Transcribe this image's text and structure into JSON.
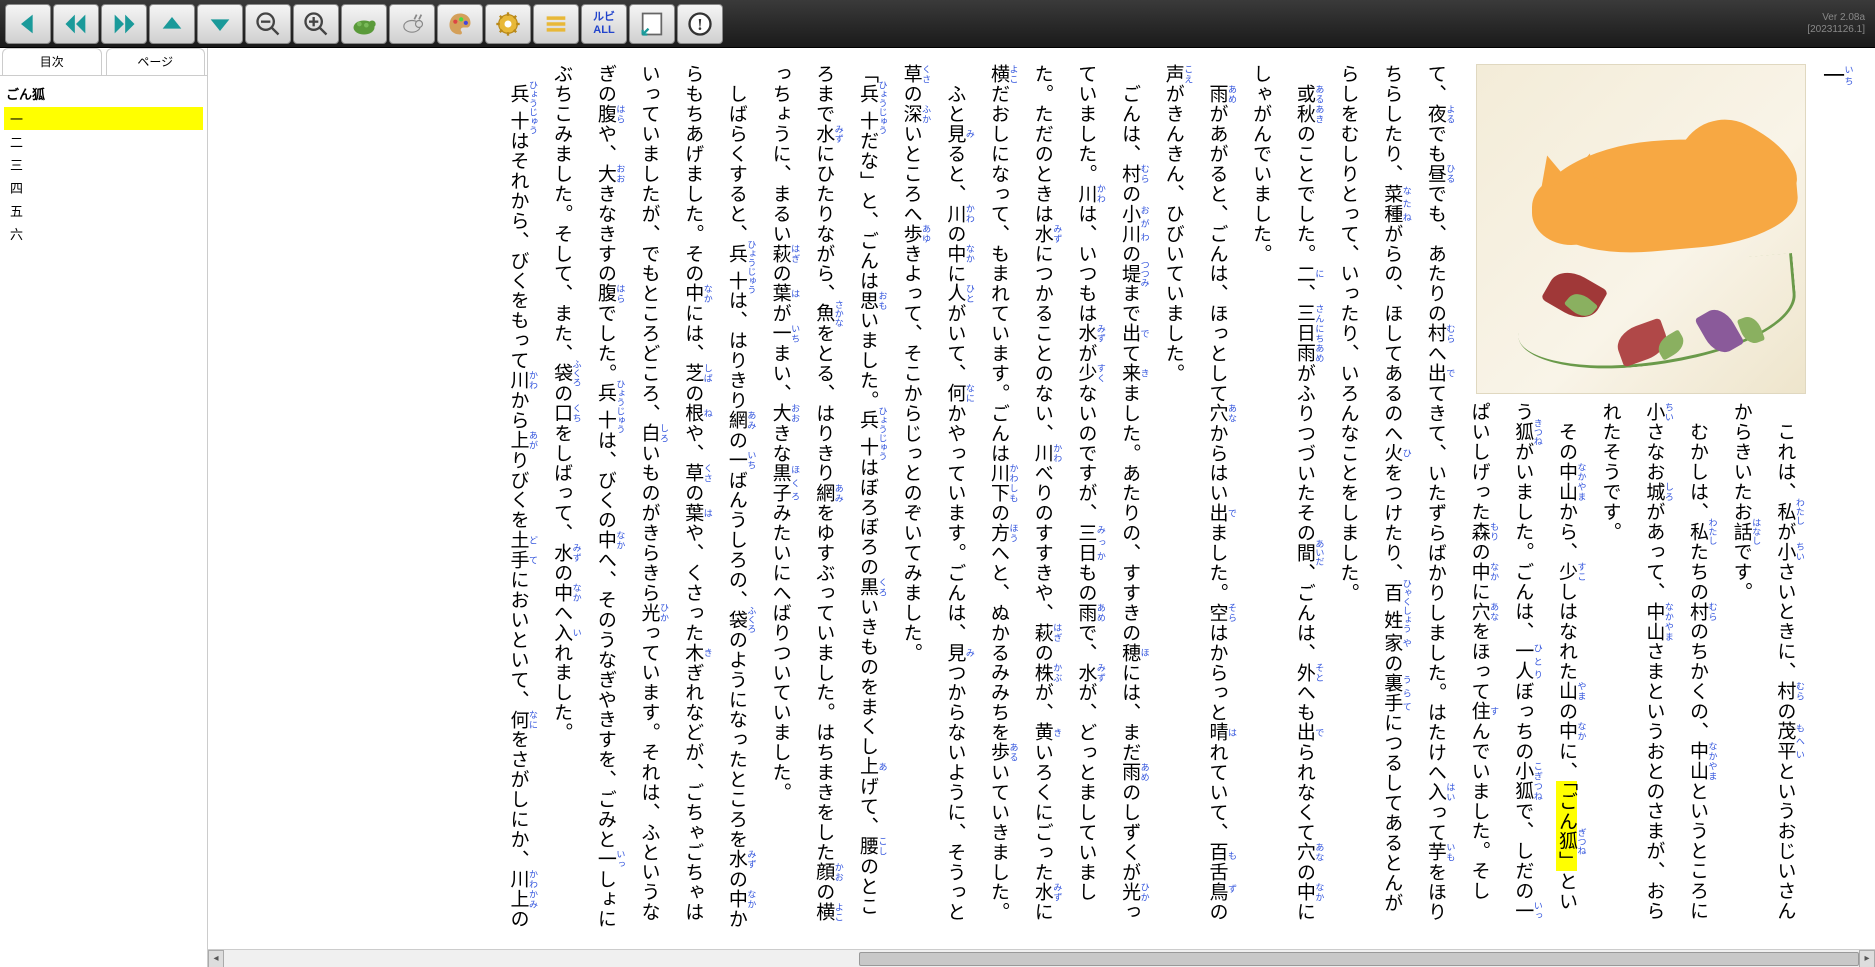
{
  "version": {
    "ver": "Ver 2.08a",
    "build": "[20231126.1]"
  },
  "toolbar": {
    "prev": "◀",
    "rewind": "◀◀",
    "forward": "▶▶",
    "up": "▲",
    "down": "▼",
    "zoom_out": "−",
    "zoom_in": "＋",
    "turtle": "🐢",
    "rabbit": "🐇",
    "palette": "🎨",
    "gear": "⚙",
    "lines": "≡",
    "ruby_all": "ルビ\nALL",
    "layout": "📄",
    "info": "!"
  },
  "sidebar": {
    "tabs": {
      "toc": "目次",
      "page": "ページ"
    },
    "title": "ごん狐",
    "items": [
      "一",
      "二",
      "三",
      "四",
      "五",
      "六"
    ],
    "current_index": 0
  },
  "chapter_marker": {
    "num": "一",
    "ruby": "いち"
  },
  "paragraphs": [
    {
      "segs": [
        {
          "t": "　これは、"
        },
        {
          "t": "私",
          "r": "わたし"
        },
        {
          "t": "が"
        },
        {
          "t": "小",
          "r": "ちい"
        },
        {
          "t": "さいときに、"
        },
        {
          "t": "村",
          "r": "むら"
        },
        {
          "t": "の"
        },
        {
          "t": "茂平",
          "r": "もへい"
        },
        {
          "t": "というおじいさんからきいたお"
        },
        {
          "t": "話",
          "r": "はなし"
        },
        {
          "t": "です。"
        }
      ]
    },
    {
      "segs": [
        {
          "t": "　むかしは、"
        },
        {
          "t": "私",
          "r": "わたし"
        },
        {
          "t": "たちの"
        },
        {
          "t": "村",
          "r": "むら"
        },
        {
          "t": "のちかくの、"
        },
        {
          "t": "中山",
          "r": "なかやま"
        },
        {
          "t": "というところに"
        },
        {
          "t": "小",
          "r": "ちい"
        },
        {
          "t": "さなお"
        },
        {
          "t": "城",
          "r": "しろ"
        },
        {
          "t": "があって、"
        },
        {
          "t": "中山",
          "r": "なかやま"
        },
        {
          "t": "さまというおとのさまが、おられたそうです。"
        }
      ]
    },
    {
      "segs": [
        {
          "t": "　その"
        },
        {
          "t": "中山",
          "r": "なかやま"
        },
        {
          "t": "から、"
        },
        {
          "t": "少",
          "r": "すこ"
        },
        {
          "t": "しはなれた"
        },
        {
          "t": "山",
          "r": "やま"
        },
        {
          "t": "の"
        },
        {
          "t": "中",
          "r": "なか"
        },
        {
          "t": "に、"
        },
        {
          "t": "「ごん",
          "hl": true
        },
        {
          "t": "狐",
          "r": "ぎつね",
          "hl": true
        },
        {
          "t": "」",
          "hl": true
        },
        {
          "t": "という"
        },
        {
          "t": "狐",
          "r": "きつね"
        },
        {
          "t": "がいました。ごんは、"
        },
        {
          "t": "一人",
          "r": "ひとり"
        },
        {
          "t": "ぼっちの"
        },
        {
          "t": "小狐",
          "r": "こぎつね"
        },
        {
          "t": "で、しだの"
        },
        {
          "t": "一",
          "r": "いっ"
        },
        {
          "t": "ぱいしげった"
        },
        {
          "t": "森",
          "r": "もり"
        },
        {
          "t": "の"
        },
        {
          "t": "中",
          "r": "なか"
        },
        {
          "t": "に"
        },
        {
          "t": "穴",
          "r": "あな"
        },
        {
          "t": "をほって"
        },
        {
          "t": "住",
          "r": "す"
        },
        {
          "t": "んでいました。そして、"
        },
        {
          "t": "夜",
          "r": "よる"
        },
        {
          "t": "でも"
        },
        {
          "t": "昼",
          "r": "ひる"
        },
        {
          "t": "でも、あたりの"
        },
        {
          "t": "村",
          "r": "むら"
        },
        {
          "t": "へ"
        },
        {
          "t": "出",
          "r": "で"
        },
        {
          "t": "てきて、いたずらばかりしました。はたけへ"
        },
        {
          "t": "入",
          "r": "はい"
        },
        {
          "t": "って"
        },
        {
          "t": "芋",
          "r": "いも"
        },
        {
          "t": "をほりちらしたり、"
        },
        {
          "t": "菜種",
          "r": "なたね"
        },
        {
          "t": "がらの、ほしてあるのへ"
        },
        {
          "t": "火",
          "r": "ひ"
        },
        {
          "t": "をつけたり、"
        },
        {
          "t": "百姓",
          "r": "ひゃくしょう"
        },
        {
          "t": "家",
          "r": "や"
        },
        {
          "t": "の"
        },
        {
          "t": "裏手",
          "r": "うらて"
        },
        {
          "t": "につるしてあるとんがらしをむしりとって、いったり、いろんなことをしました。"
        }
      ]
    },
    {
      "segs": [
        {
          "t": "　"
        },
        {
          "t": "或",
          "r": "ある"
        },
        {
          "t": "秋",
          "r": "あき"
        },
        {
          "t": "のことでした。"
        },
        {
          "t": "二",
          "r": "に"
        },
        {
          "t": "、"
        },
        {
          "t": "三日",
          "r": "さんにち"
        },
        {
          "t": "雨",
          "r": "あめ"
        },
        {
          "t": "がふりつづいたその"
        },
        {
          "t": "間",
          "r": "あいだ"
        },
        {
          "t": "、ごんは、"
        },
        {
          "t": "外",
          "r": "そと"
        },
        {
          "t": "へも"
        },
        {
          "t": "出",
          "r": "で"
        },
        {
          "t": "られなくて"
        },
        {
          "t": "穴",
          "r": "あな"
        },
        {
          "t": "の"
        },
        {
          "t": "中",
          "r": "なか"
        },
        {
          "t": "にしゃがんでいました。"
        }
      ]
    },
    {
      "segs": [
        {
          "t": "　"
        },
        {
          "t": "雨",
          "r": "あめ"
        },
        {
          "t": "があがると、ごんは、ほっとして"
        },
        {
          "t": "穴",
          "r": "あな"
        },
        {
          "t": "からはい"
        },
        {
          "t": "出",
          "r": "で"
        },
        {
          "t": "ました。"
        },
        {
          "t": "空",
          "r": "そら"
        },
        {
          "t": "はからっと"
        },
        {
          "t": "晴",
          "r": "は"
        },
        {
          "t": "れていて、"
        },
        {
          "t": "百舌鳥",
          "r": "もず"
        },
        {
          "t": "の"
        },
        {
          "t": "声",
          "r": "こえ"
        },
        {
          "t": "がきんきん、ひびいていました。"
        }
      ]
    },
    {
      "segs": [
        {
          "t": "　ごんは、"
        },
        {
          "t": "村",
          "r": "むら"
        },
        {
          "t": "の"
        },
        {
          "t": "小川",
          "r": "おがわ"
        },
        {
          "t": "の"
        },
        {
          "t": "堤",
          "r": "つつみ"
        },
        {
          "t": "まで"
        },
        {
          "t": "出",
          "r": "で"
        },
        {
          "t": "て"
        },
        {
          "t": "来",
          "r": "き"
        },
        {
          "t": "ました。あたりの、すすきの"
        },
        {
          "t": "穂",
          "r": "ほ"
        },
        {
          "t": "には、まだ"
        },
        {
          "t": "雨",
          "r": "あめ"
        },
        {
          "t": "のしずくが"
        },
        {
          "t": "光",
          "r": "ひか"
        },
        {
          "t": "っていました。"
        },
        {
          "t": "川",
          "r": "かわ"
        },
        {
          "t": "は、いつもは"
        },
        {
          "t": "水",
          "r": "みず"
        },
        {
          "t": "が"
        },
        {
          "t": "少",
          "r": "すく"
        },
        {
          "t": "ないのですが、"
        },
        {
          "t": "三日",
          "r": "みっか"
        },
        {
          "t": "もの"
        },
        {
          "t": "雨",
          "r": "あめ"
        },
        {
          "t": "で、"
        },
        {
          "t": "水",
          "r": "みず"
        },
        {
          "t": "が、どっとましていました。ただのときは"
        },
        {
          "t": "水",
          "r": "みず"
        },
        {
          "t": "につかることのない、"
        },
        {
          "t": "川",
          "r": "かわ"
        },
        {
          "t": "べりのすすきや、"
        },
        {
          "t": "萩",
          "r": "はぎ"
        },
        {
          "t": "の"
        },
        {
          "t": "株",
          "r": "かぶ"
        },
        {
          "t": "が、"
        },
        {
          "t": "黄",
          "r": "き"
        },
        {
          "t": "いろくにごった"
        },
        {
          "t": "水",
          "r": "みず"
        },
        {
          "t": "に"
        },
        {
          "t": "横",
          "r": "よこ"
        },
        {
          "t": "だおしになって、もまれています。ごんは"
        },
        {
          "t": "川下",
          "r": "かわしも"
        },
        {
          "t": "の"
        },
        {
          "t": "方",
          "r": "ほう"
        },
        {
          "t": "へと、ぬかるみみちを"
        },
        {
          "t": "歩",
          "r": "ある"
        },
        {
          "t": "いていきました。"
        }
      ]
    },
    {
      "segs": [
        {
          "t": "　ふと"
        },
        {
          "t": "見",
          "r": "み"
        },
        {
          "t": "ると、"
        },
        {
          "t": "川",
          "r": "かわ"
        },
        {
          "t": "の"
        },
        {
          "t": "中",
          "r": "なか"
        },
        {
          "t": "に"
        },
        {
          "t": "人",
          "r": "ひと"
        },
        {
          "t": "がいて、"
        },
        {
          "t": "何",
          "r": "なに"
        },
        {
          "t": "かやっています。ごんは、"
        },
        {
          "t": "見",
          "r": "み"
        },
        {
          "t": "つからないように、そうっと"
        },
        {
          "t": "草",
          "r": "くさ"
        },
        {
          "t": "の"
        },
        {
          "t": "深",
          "r": "ふか"
        },
        {
          "t": "いところへ"
        },
        {
          "t": "歩",
          "r": "あゆ"
        },
        {
          "t": "きよって、そこからじっとのぞいてみました。"
        }
      ]
    },
    {
      "segs": [
        {
          "t": "「"
        },
        {
          "t": "兵十",
          "r": "ひょうじゅう"
        },
        {
          "t": "だな」と、ごんは"
        },
        {
          "t": "思",
          "r": "おも"
        },
        {
          "t": "いました。"
        },
        {
          "t": "兵十",
          "r": "ひょうじゅう"
        },
        {
          "t": "はぼろぼろの"
        },
        {
          "t": "黒",
          "r": "くろ"
        },
        {
          "t": "いきものをまくし"
        },
        {
          "t": "上",
          "r": "あ"
        },
        {
          "t": "げて、"
        },
        {
          "t": "腰",
          "r": "こし"
        },
        {
          "t": "のところまで"
        },
        {
          "t": "水",
          "r": "みず"
        },
        {
          "t": "にひたりながら、"
        },
        {
          "t": "魚",
          "r": "さかな"
        },
        {
          "t": "をとる、はりきり"
        },
        {
          "t": "網",
          "r": "あみ"
        },
        {
          "t": "をゆすぶっていました。はちまきをした"
        },
        {
          "t": "顔",
          "r": "かお"
        },
        {
          "t": "の"
        },
        {
          "t": "横",
          "r": "よこ"
        },
        {
          "t": "っちょうに、まるい"
        },
        {
          "t": "萩",
          "r": "はぎ"
        },
        {
          "t": "の"
        },
        {
          "t": "葉",
          "r": "は"
        },
        {
          "t": "が"
        },
        {
          "t": "一",
          "r": "いち"
        },
        {
          "t": "まい、"
        },
        {
          "t": "大",
          "r": "おお"
        },
        {
          "t": "きな"
        },
        {
          "t": "黒子",
          "r": "ほくろ"
        },
        {
          "t": "みたいにへばりついていました。"
        }
      ]
    },
    {
      "segs": [
        {
          "t": "　しばらくすると、"
        },
        {
          "t": "兵十",
          "r": "ひょうじゅう"
        },
        {
          "t": "は、はりきり"
        },
        {
          "t": "網",
          "r": "あみ"
        },
        {
          "t": "の"
        },
        {
          "t": "一",
          "r": "いち"
        },
        {
          "t": "ばんうしろの、"
        },
        {
          "t": "袋",
          "r": "ふくろ"
        },
        {
          "t": "のようになったところを"
        },
        {
          "t": "水",
          "r": "みず"
        },
        {
          "t": "の"
        },
        {
          "t": "中",
          "r": "なか"
        },
        {
          "t": "からもちあげました。その"
        },
        {
          "t": "中",
          "r": "なか"
        },
        {
          "t": "には、"
        },
        {
          "t": "芝",
          "r": "しば"
        },
        {
          "t": "の"
        },
        {
          "t": "根",
          "r": "ね"
        },
        {
          "t": "や、"
        },
        {
          "t": "草",
          "r": "くさ"
        },
        {
          "t": "の"
        },
        {
          "t": "葉",
          "r": "は"
        },
        {
          "t": "や、くさった"
        },
        {
          "t": "木",
          "r": "き"
        },
        {
          "t": "ぎれなどが、ごちゃごちゃはいっていましたが、でもところどころ、"
        },
        {
          "t": "白",
          "r": "しろ"
        },
        {
          "t": "いものがきらきら"
        },
        {
          "t": "光",
          "r": "ひか"
        },
        {
          "t": "っています。それは、ふというなぎの"
        },
        {
          "t": "腹",
          "r": "はら"
        },
        {
          "t": "や、"
        },
        {
          "t": "大",
          "r": "おお"
        },
        {
          "t": "きなきすの"
        },
        {
          "t": "腹",
          "r": "はら"
        },
        {
          "t": "でした。"
        },
        {
          "t": "兵十",
          "r": "ひょうじゅう"
        },
        {
          "t": "は、びくの"
        },
        {
          "t": "中",
          "r": "なか"
        },
        {
          "t": "へ、そのうなぎやきすを、ごみと"
        },
        {
          "t": "一",
          "r": "いっ"
        },
        {
          "t": "しょにぶちこみました。そして、また、"
        },
        {
          "t": "袋",
          "r": "ふくろ"
        },
        {
          "t": "の"
        },
        {
          "t": "口",
          "r": "くち"
        },
        {
          "t": "をしばって、"
        },
        {
          "t": "水",
          "r": "みず"
        },
        {
          "t": "の"
        },
        {
          "t": "中",
          "r": "なか"
        },
        {
          "t": "へ"
        },
        {
          "t": "入",
          "r": "い"
        },
        {
          "t": "れました。"
        }
      ]
    },
    {
      "segs": [
        {
          "t": "　"
        },
        {
          "t": "兵十",
          "r": "ひょうじゅう"
        },
        {
          "t": "はそれから、びくをもって"
        },
        {
          "t": "川",
          "r": "かわ"
        },
        {
          "t": "から"
        },
        {
          "t": "上",
          "r": "あが"
        },
        {
          "t": "りびくを"
        },
        {
          "t": "土手",
          "r": "どて"
        },
        {
          "t": "においといて、"
        },
        {
          "t": "何",
          "r": "なに"
        },
        {
          "t": "をさがしにか、"
        },
        {
          "t": "川上",
          "r": "かわかみ"
        },
        {
          "t": "の"
        }
      ]
    }
  ]
}
